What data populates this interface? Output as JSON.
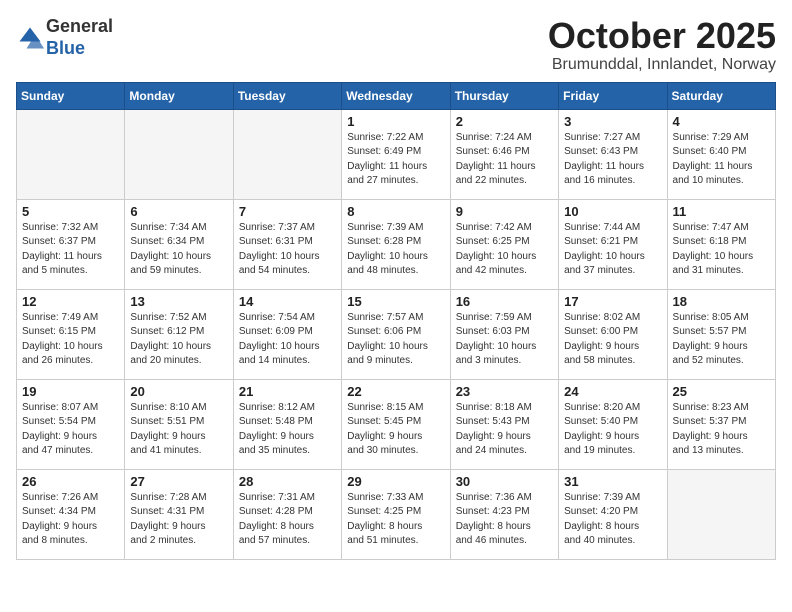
{
  "header": {
    "logo_general": "General",
    "logo_blue": "Blue",
    "title": "October 2025",
    "subtitle": "Brumunddal, Innlandet, Norway"
  },
  "weekdays": [
    "Sunday",
    "Monday",
    "Tuesday",
    "Wednesday",
    "Thursday",
    "Friday",
    "Saturday"
  ],
  "weeks": [
    [
      {
        "day": "",
        "info": ""
      },
      {
        "day": "",
        "info": ""
      },
      {
        "day": "",
        "info": ""
      },
      {
        "day": "1",
        "info": "Sunrise: 7:22 AM\nSunset: 6:49 PM\nDaylight: 11 hours\nand 27 minutes."
      },
      {
        "day": "2",
        "info": "Sunrise: 7:24 AM\nSunset: 6:46 PM\nDaylight: 11 hours\nand 22 minutes."
      },
      {
        "day": "3",
        "info": "Sunrise: 7:27 AM\nSunset: 6:43 PM\nDaylight: 11 hours\nand 16 minutes."
      },
      {
        "day": "4",
        "info": "Sunrise: 7:29 AM\nSunset: 6:40 PM\nDaylight: 11 hours\nand 10 minutes."
      }
    ],
    [
      {
        "day": "5",
        "info": "Sunrise: 7:32 AM\nSunset: 6:37 PM\nDaylight: 11 hours\nand 5 minutes."
      },
      {
        "day": "6",
        "info": "Sunrise: 7:34 AM\nSunset: 6:34 PM\nDaylight: 10 hours\nand 59 minutes."
      },
      {
        "day": "7",
        "info": "Sunrise: 7:37 AM\nSunset: 6:31 PM\nDaylight: 10 hours\nand 54 minutes."
      },
      {
        "day": "8",
        "info": "Sunrise: 7:39 AM\nSunset: 6:28 PM\nDaylight: 10 hours\nand 48 minutes."
      },
      {
        "day": "9",
        "info": "Sunrise: 7:42 AM\nSunset: 6:25 PM\nDaylight: 10 hours\nand 42 minutes."
      },
      {
        "day": "10",
        "info": "Sunrise: 7:44 AM\nSunset: 6:21 PM\nDaylight: 10 hours\nand 37 minutes."
      },
      {
        "day": "11",
        "info": "Sunrise: 7:47 AM\nSunset: 6:18 PM\nDaylight: 10 hours\nand 31 minutes."
      }
    ],
    [
      {
        "day": "12",
        "info": "Sunrise: 7:49 AM\nSunset: 6:15 PM\nDaylight: 10 hours\nand 26 minutes."
      },
      {
        "day": "13",
        "info": "Sunrise: 7:52 AM\nSunset: 6:12 PM\nDaylight: 10 hours\nand 20 minutes."
      },
      {
        "day": "14",
        "info": "Sunrise: 7:54 AM\nSunset: 6:09 PM\nDaylight: 10 hours\nand 14 minutes."
      },
      {
        "day": "15",
        "info": "Sunrise: 7:57 AM\nSunset: 6:06 PM\nDaylight: 10 hours\nand 9 minutes."
      },
      {
        "day": "16",
        "info": "Sunrise: 7:59 AM\nSunset: 6:03 PM\nDaylight: 10 hours\nand 3 minutes."
      },
      {
        "day": "17",
        "info": "Sunrise: 8:02 AM\nSunset: 6:00 PM\nDaylight: 9 hours\nand 58 minutes."
      },
      {
        "day": "18",
        "info": "Sunrise: 8:05 AM\nSunset: 5:57 PM\nDaylight: 9 hours\nand 52 minutes."
      }
    ],
    [
      {
        "day": "19",
        "info": "Sunrise: 8:07 AM\nSunset: 5:54 PM\nDaylight: 9 hours\nand 47 minutes."
      },
      {
        "day": "20",
        "info": "Sunrise: 8:10 AM\nSunset: 5:51 PM\nDaylight: 9 hours\nand 41 minutes."
      },
      {
        "day": "21",
        "info": "Sunrise: 8:12 AM\nSunset: 5:48 PM\nDaylight: 9 hours\nand 35 minutes."
      },
      {
        "day": "22",
        "info": "Sunrise: 8:15 AM\nSunset: 5:45 PM\nDaylight: 9 hours\nand 30 minutes."
      },
      {
        "day": "23",
        "info": "Sunrise: 8:18 AM\nSunset: 5:43 PM\nDaylight: 9 hours\nand 24 minutes."
      },
      {
        "day": "24",
        "info": "Sunrise: 8:20 AM\nSunset: 5:40 PM\nDaylight: 9 hours\nand 19 minutes."
      },
      {
        "day": "25",
        "info": "Sunrise: 8:23 AM\nSunset: 5:37 PM\nDaylight: 9 hours\nand 13 minutes."
      }
    ],
    [
      {
        "day": "26",
        "info": "Sunrise: 7:26 AM\nSunset: 4:34 PM\nDaylight: 9 hours\nand 8 minutes."
      },
      {
        "day": "27",
        "info": "Sunrise: 7:28 AM\nSunset: 4:31 PM\nDaylight: 9 hours\nand 2 minutes."
      },
      {
        "day": "28",
        "info": "Sunrise: 7:31 AM\nSunset: 4:28 PM\nDaylight: 8 hours\nand 57 minutes."
      },
      {
        "day": "29",
        "info": "Sunrise: 7:33 AM\nSunset: 4:25 PM\nDaylight: 8 hours\nand 51 minutes."
      },
      {
        "day": "30",
        "info": "Sunrise: 7:36 AM\nSunset: 4:23 PM\nDaylight: 8 hours\nand 46 minutes."
      },
      {
        "day": "31",
        "info": "Sunrise: 7:39 AM\nSunset: 4:20 PM\nDaylight: 8 hours\nand 40 minutes."
      },
      {
        "day": "",
        "info": ""
      }
    ]
  ]
}
